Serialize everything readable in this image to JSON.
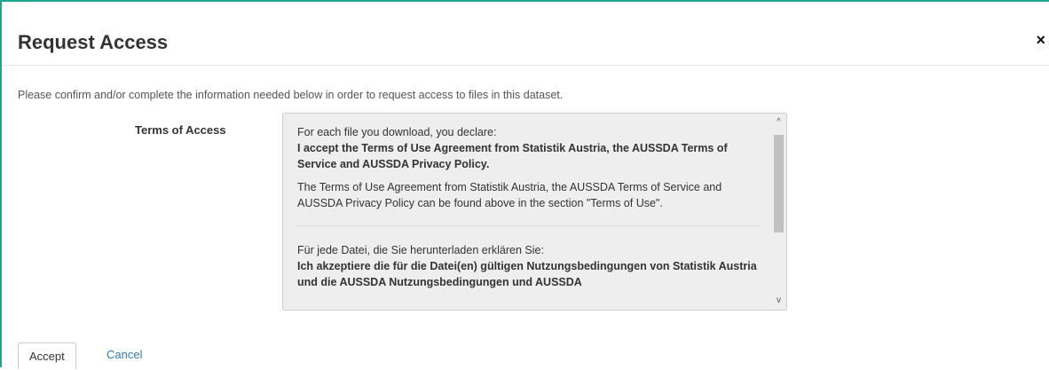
{
  "modal": {
    "title": "Request Access",
    "close_label": "×",
    "intro": "Please confirm and/or complete the information needed below in order to request access to files in this dataset.",
    "terms_label": "Terms of Access",
    "terms": {
      "en_line1": "For each file you download, you declare:",
      "en_bold": "I accept the Terms of Use Agreement from Statistik Austria, the AUSSDA Terms of Service and AUSSDA Privacy Policy.",
      "en_note": "The Terms of Use Agreement from Statistik Austria, the AUSSDA Terms of Service and AUSSDA Privacy Policy can be found above in the section \"Terms of Use\".",
      "de_line1": "Für jede Datei, die Sie herunterladen erklären Sie:",
      "de_bold": "Ich akzeptiere die für die Datei(en) gültigen Nutzungsbedingungen von Statistik Austria und die AUSSDA Nutzungsbedingungen und AUSSDA"
    },
    "scroll_up": "^",
    "scroll_down": "v",
    "accept_label": "Accept",
    "cancel_label": "Cancel"
  },
  "colors": {
    "accent_border": "#1aa88f",
    "link": "#337ab7"
  }
}
